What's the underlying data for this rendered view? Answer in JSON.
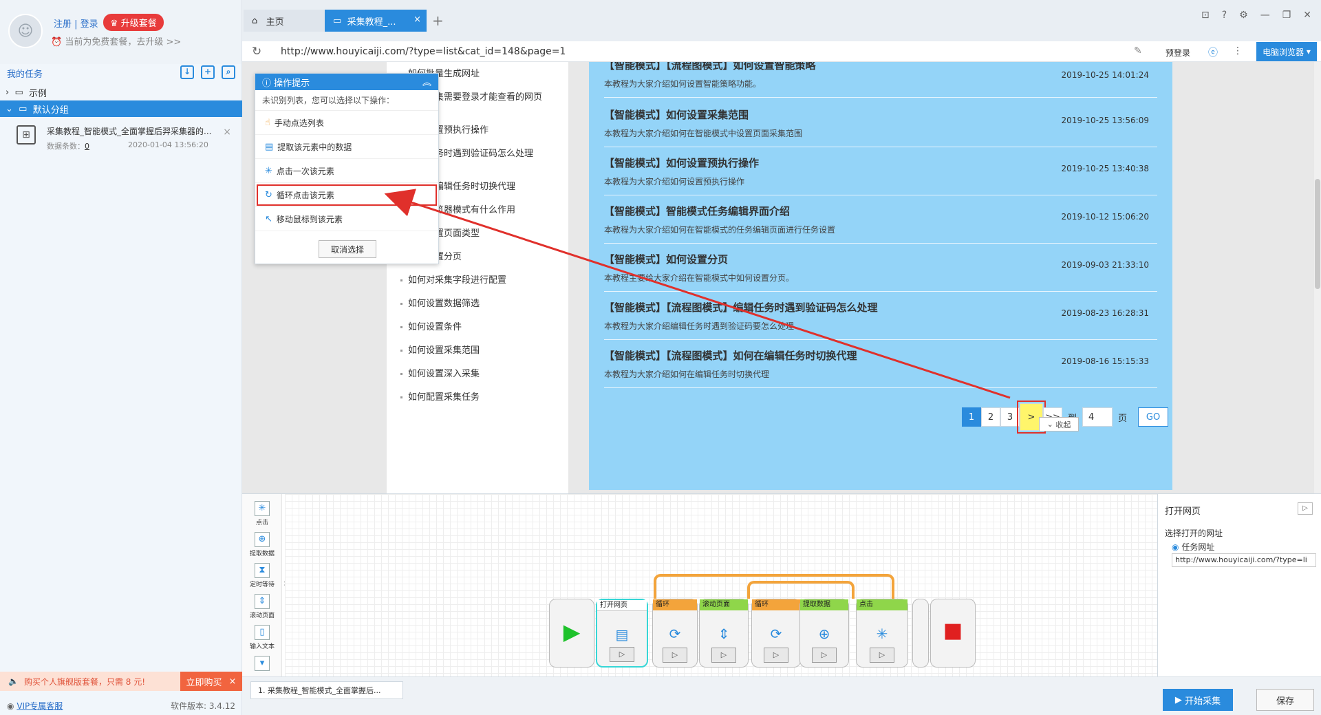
{
  "user": {
    "register": "注册",
    "sep": " | ",
    "login": "登录",
    "upgrade": "升级套餐",
    "plan": "当前为免费套餐，去升级 >>"
  },
  "tasks": {
    "header": "我的任务",
    "groups": [
      {
        "label": "示例"
      },
      {
        "label": "默认分组"
      }
    ],
    "item": {
      "name": "采集教程_智能模式_全面掌握后羿采集器的...",
      "count_label": "数据条数：",
      "count": "0",
      "date": "2020-01-04 13:56:20"
    }
  },
  "promo": {
    "text": "购买个人旗舰版套餐，只需 8 元!",
    "buy": "立即购买"
  },
  "bottom": {
    "vip": "VIP专属客服",
    "version": "软件版本: 3.4.12"
  },
  "tabs": [
    {
      "label": "主页"
    },
    {
      "label": "采集教程_..."
    }
  ],
  "address": {
    "url": "http://www.houyicaiji.com/?type=list&cat_id=148&page=1",
    "prelogin": "预登录",
    "browser_mode": "电脑浏览器"
  },
  "menu": [
    "如何批量生成网址",
    "如何采集需要登录才能查看的网页",
    "如何设置预执行操作",
    "编辑任务时遇到验证码怎么处理",
    "如何在编辑任务时切换代理",
    "切换浏览器模式有什么作用",
    "如何设置页面类型",
    "如何设置分页",
    "如何对采集字段进行配置",
    "如何设置数据筛选",
    "如何设置条件",
    "如何设置采集范围",
    "如何设置深入采集",
    "如何配置采集任务"
  ],
  "articles": [
    {
      "title": "【智能模式】【流程图模式】如何设置智能策略",
      "desc": "本教程为大家介绍如何设置智能策略功能。",
      "date": "2019-10-25 14:01:24"
    },
    {
      "title": "【智能模式】如何设置采集范围",
      "desc": "本教程为大家介绍如何在智能模式中设置页面采集范围",
      "date": "2019-10-25 13:56:09"
    },
    {
      "title": "【智能模式】如何设置预执行操作",
      "desc": "本教程为大家介绍如何设置预执行操作",
      "date": "2019-10-25 13:40:38"
    },
    {
      "title": "【智能模式】智能模式任务编辑界面介绍",
      "desc": "本教程为大家介绍如何在智能模式的任务编辑页面进行任务设置",
      "date": "2019-10-12 15:06:20"
    },
    {
      "title": "【智能模式】如何设置分页",
      "desc": "本教程主要给大家介绍在智能模式中如何设置分页。",
      "date": "2019-09-03 21:33:10"
    },
    {
      "title": "【智能模式】【流程图模式】编辑任务时遇到验证码怎么处理",
      "desc": "本教程为大家介绍编辑任务时遇到验证码要怎么处理",
      "date": "2019-08-23 16:28:31"
    },
    {
      "title": "【智能模式】【流程图模式】如何在编辑任务时切换代理",
      "desc": "本教程为大家介绍如何在编辑任务时切换代理",
      "date": "2019-08-16 15:15:33"
    }
  ],
  "pager": {
    "pages": [
      "1",
      "2",
      "3"
    ],
    "next": ">",
    "last": ">>",
    "to": "到",
    "page_value": "4",
    "page_unit": "页",
    "go": "GO"
  },
  "collapse": "收起",
  "tip": {
    "title": "操作提示",
    "subtitle": "未识别列表，您可以选择以下操作：",
    "items": [
      "手动点选列表",
      "提取该元素中的数据",
      "点击一次该元素",
      "循环点击该元素",
      "移动鼠标到该元素"
    ],
    "cancel": "取消选择"
  },
  "toolbox": [
    "点击",
    "提取数据",
    "定时等待",
    "滚动页面",
    "输入文本"
  ],
  "nodes": [
    "打开网页",
    "循环",
    "滚动页面",
    "循环",
    "提取数据",
    "点击"
  ],
  "props": {
    "title": "打开网页",
    "label": "选择打开的网址",
    "radio": "任务网址",
    "url": "http://www.houyicaiji.com/?type=li"
  },
  "footer": {
    "flow_tab": "1. 采集教程_智能模式_全面掌握后...",
    "start": "开始采集",
    "save": "保存"
  },
  "colors": {
    "accent": "#2a8bdd",
    "highlight": "#e0302b",
    "panel": "#94d4f8"
  }
}
